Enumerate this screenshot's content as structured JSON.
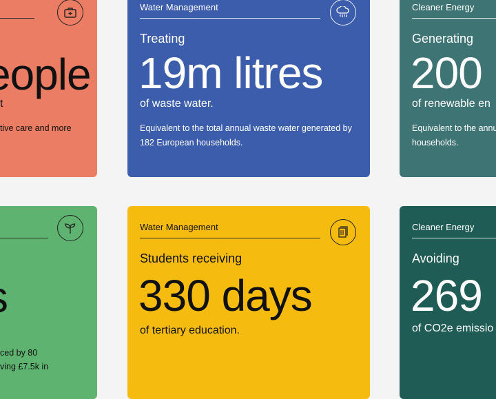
{
  "cards": {
    "c1": {
      "big": "eople",
      "sub": "t",
      "note": "tive care and more",
      "icon": "medical-kit-icon",
      "bg": "#ea7d63"
    },
    "c2": {
      "category": "Water Management",
      "lead": "Treating",
      "big": "19m litres",
      "sub": "of waste water.",
      "note": "Equivalent to the total annual waste water generated by 182 European households.",
      "icon": "rain-cloud-icon",
      "bg": "#3b5dab"
    },
    "c3": {
      "category": "Cleaner Energy",
      "lead": "Generating",
      "big": "200",
      "sub": "of renewable en",
      "note_line1": "Equivalent to the annu",
      "note_line2": "households.",
      "bg": "#3f7474"
    },
    "c4": {
      "big": "s",
      "note_line1": "ced by 80",
      "note_line2": "ving £7.5k in",
      "icon": "sprout-icon",
      "bg": "#5db36f"
    },
    "c5": {
      "category": "Water Management",
      "lead": "Students receiving",
      "big": "330 days",
      "sub": "of tertiary education.",
      "icon": "books-icon",
      "bg": "#f6bb0f"
    },
    "c6": {
      "category": "Cleaner Energy",
      "lead": "Avoiding",
      "big": "269",
      "sub": "of CO2e emissio",
      "bg": "#1f5c56"
    }
  }
}
